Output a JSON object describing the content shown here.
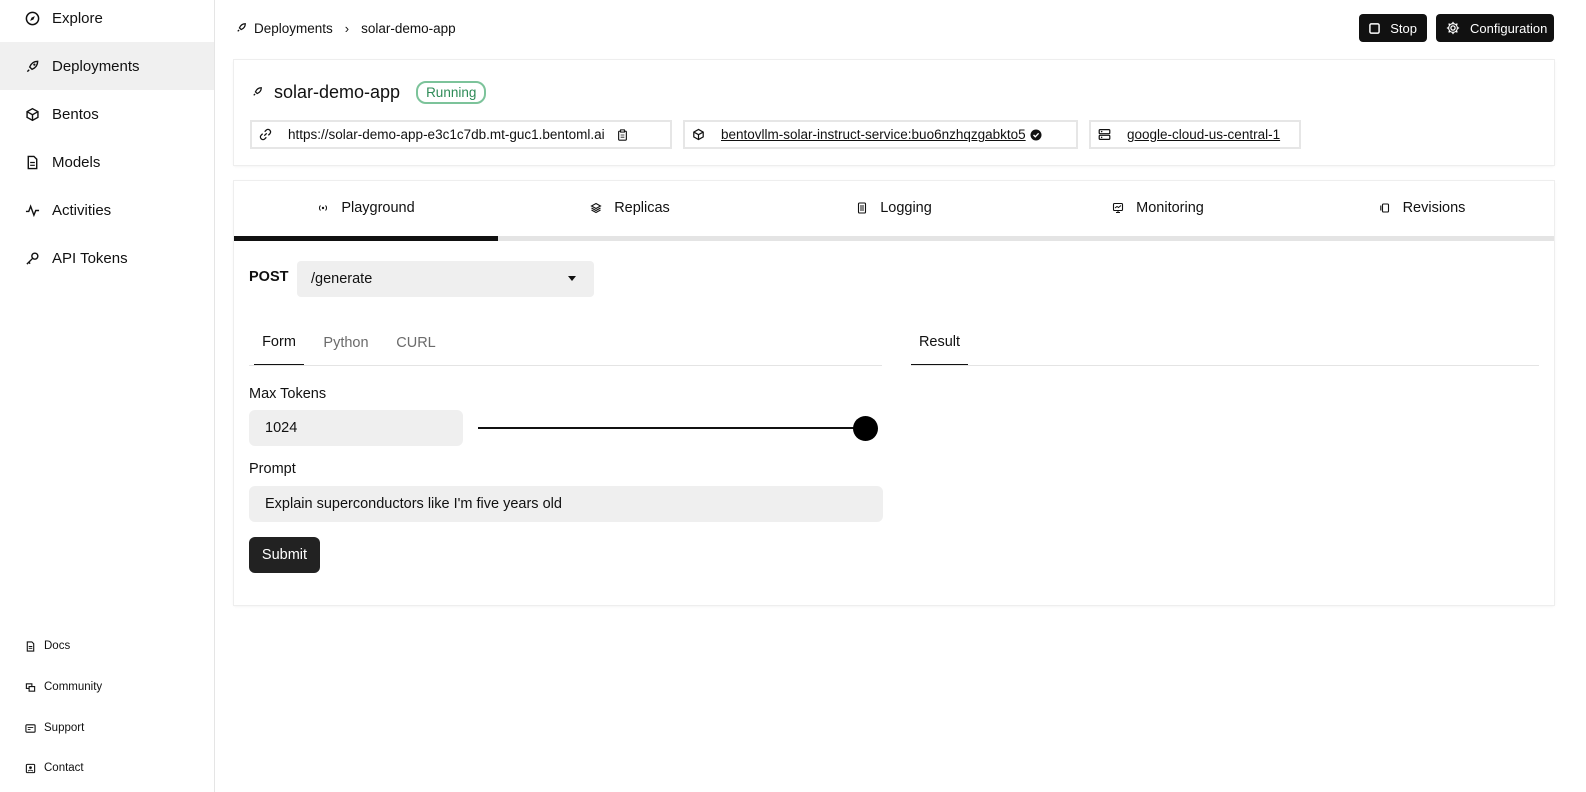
{
  "sidebar": {
    "items": [
      {
        "label": "Explore",
        "icon": "compass-icon"
      },
      {
        "label": "Deployments",
        "icon": "rocket-icon"
      },
      {
        "label": "Bentos",
        "icon": "box-icon"
      },
      {
        "label": "Models",
        "icon": "file-icon"
      },
      {
        "label": "Activities",
        "icon": "activity-icon"
      },
      {
        "label": "API Tokens",
        "icon": "key-icon"
      }
    ],
    "active_index": 1,
    "footer": [
      {
        "label": "Docs",
        "icon": "doc-icon"
      },
      {
        "label": "Community",
        "icon": "community-icon"
      },
      {
        "label": "Support",
        "icon": "support-icon"
      },
      {
        "label": "Contact",
        "icon": "contact-icon"
      }
    ]
  },
  "header": {
    "breadcrumb": [
      "Deployments",
      "solar-demo-app"
    ],
    "stop_label": "Stop",
    "configuration_label": "Configuration"
  },
  "deployment": {
    "name": "solar-demo-app",
    "status": "Running",
    "url": "https://solar-demo-app-e3c1c7db.mt-guc1.bentoml.ai",
    "bento": "bentovllm-solar-instruct-service:buo6nzhqzgabkto5",
    "cluster": "google-cloud-us-central-1"
  },
  "tabs": [
    "Playground",
    "Replicas",
    "Logging",
    "Monitoring",
    "Revisions"
  ],
  "active_tab": "Playground",
  "playground": {
    "method": "POST",
    "endpoint": "/generate",
    "code_tabs": [
      "Form",
      "Python",
      "CURL"
    ],
    "active_code_tab": "Form",
    "result_tab": "Result",
    "max_tokens_label": "Max Tokens",
    "max_tokens_value": "1024",
    "max_tokens_slider_fraction": 1.0,
    "prompt_label": "Prompt",
    "prompt_value": "Explain superconductors like I'm five years old",
    "submit_label": "Submit"
  },
  "colors": {
    "accent": "#111111",
    "status_running_border": "#7cc39a",
    "status_running_text": "#2e8b57",
    "active_nav_bg": "#f0f0f0",
    "input_bg": "#efefef"
  }
}
